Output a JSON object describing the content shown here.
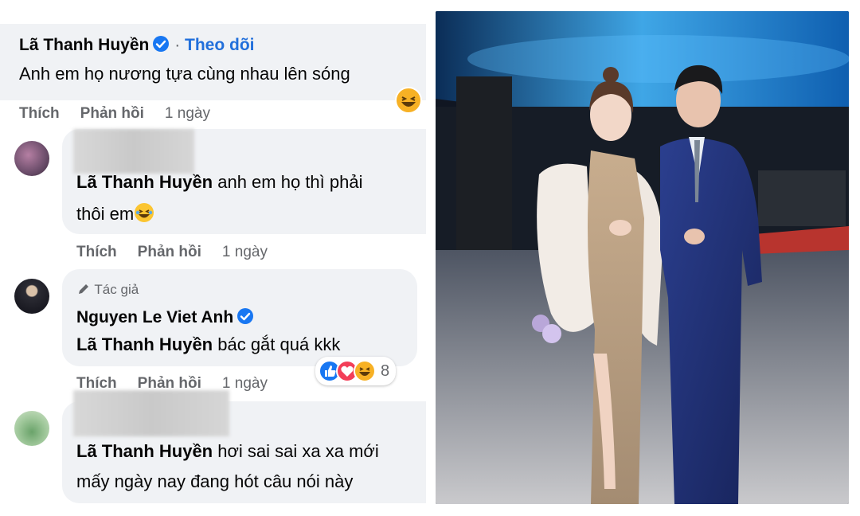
{
  "comments": [
    {
      "author": "Lã Thanh Huyền",
      "follow_prefix": " · ",
      "follow": "Theo dõi",
      "text": "Anh em họ nương tựa cùng nhau lên sóng",
      "actions": {
        "like": "Thích",
        "reply": "Phản hồi",
        "time": "1 ngày"
      }
    },
    {
      "tag": "Lã Thanh Huyền",
      "text_line1": " anh em họ thì phải",
      "text_line2": "thôi em",
      "actions": {
        "like": "Thích",
        "reply": "Phản hồi",
        "time": "1 ngày"
      }
    },
    {
      "author_label": "Tác giả",
      "author": "Nguyen Le Viet Anh",
      "tag": "Lã Thanh Huyền",
      "text": " bác gắt quá kkk",
      "reactions_count": "8",
      "actions": {
        "like": "Thích",
        "reply": "Phản hồi",
        "time": "1 ngày"
      }
    },
    {
      "tag": "Lã Thanh Huyền",
      "text_line1": " hơi sai sai xa xa mới",
      "text_line2": "mấy ngày nay đang hót câu nói này"
    }
  ],
  "colors": {
    "link": "#216fdb",
    "bubble": "#f0f2f5",
    "muted": "#65676b",
    "verified": "#1877f2"
  }
}
